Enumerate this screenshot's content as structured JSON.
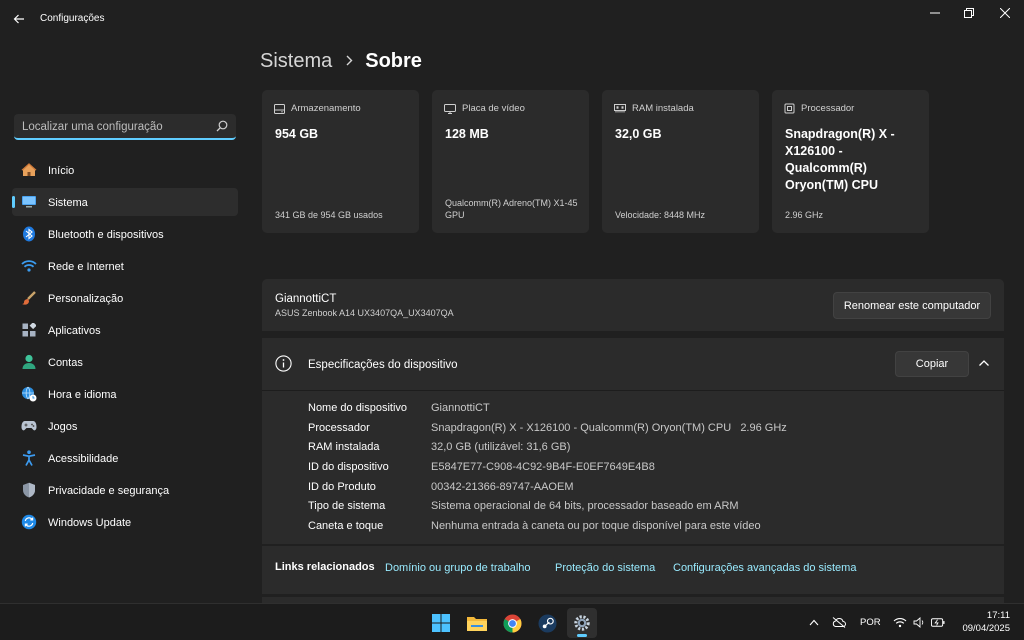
{
  "window": {
    "title": "Configurações"
  },
  "search": {
    "placeholder": "Localizar uma configuração"
  },
  "sidebar": {
    "items": [
      {
        "label": "Início"
      },
      {
        "label": "Sistema"
      },
      {
        "label": "Bluetooth e dispositivos"
      },
      {
        "label": "Rede e Internet"
      },
      {
        "label": "Personalização"
      },
      {
        "label": "Aplicativos"
      },
      {
        "label": "Contas"
      },
      {
        "label": "Hora e idioma"
      },
      {
        "label": "Jogos"
      },
      {
        "label": "Acessibilidade"
      },
      {
        "label": "Privacidade e segurança"
      },
      {
        "label": "Windows Update"
      }
    ],
    "active": "Sistema"
  },
  "breadcrumb": {
    "parent": "Sistema",
    "current": "Sobre"
  },
  "cards": [
    {
      "title": "Armazenamento",
      "value": "954 GB",
      "footer": "341 GB de 954 GB usados",
      "icon": "storage-icon"
    },
    {
      "title": "Placa de vídeo",
      "value": "128 MB",
      "footer": "Qualcomm(R) Adreno(TM) X1-45 GPU",
      "icon": "gpu-icon"
    },
    {
      "title": "RAM instalada",
      "value": "32,0 GB",
      "footer": "Velocidade: 8448 MHz",
      "icon": "ram-icon"
    },
    {
      "title": "Processador",
      "value": "Snapdragon(R) X - X126100 - Qualcomm(R) Oryon(TM) CPU",
      "footer": "2.96 GHz",
      "icon": "cpu-icon"
    }
  ],
  "computer": {
    "name": "GiannottiCT",
    "model": "ASUS Zenbook A14 UX3407QA_UX3407QA",
    "rename_label": "Renomear este computador"
  },
  "specs": {
    "title": "Especificações do dispositivo",
    "copy_label": "Copiar",
    "rows": [
      {
        "key": "Nome do dispositivo",
        "value": "GiannottiCT"
      },
      {
        "key": "Processador",
        "value": "Snapdragon(R) X - X126100 - Qualcomm(R) Oryon(TM) CPU   2.96 GHz"
      },
      {
        "key": "RAM instalada",
        "value": "32,0 GB (utilizável: 31,6 GB)"
      },
      {
        "key": "ID do dispositivo",
        "value": "E5847E77-C908-4C92-9B4F-E0EF7649E4B8"
      },
      {
        "key": "ID do Produto",
        "value": "00342-21366-89747-AAOEM"
      },
      {
        "key": "Tipo de sistema",
        "value": "Sistema operacional de 64 bits, processador baseado em ARM"
      },
      {
        "key": "Caneta e toque",
        "value": "Nenhuma entrada à caneta ou por toque disponível para este vídeo"
      }
    ]
  },
  "links": {
    "label": "Links relacionados",
    "items": [
      {
        "label": "Domínio ou grupo de trabalho"
      },
      {
        "label": "Proteção do sistema"
      },
      {
        "label": "Configurações avançadas do sistema"
      }
    ]
  },
  "taskbar": {
    "apps": [
      "windows-start-icon",
      "file-explorer-icon",
      "chrome-icon",
      "steam-icon",
      "settings-icon"
    ],
    "language": "POR",
    "time": "17:11",
    "date": "09/04/2025"
  },
  "colors": {
    "accent": "#60cdff",
    "link": "#99ebff",
    "background": "#202020",
    "card": "#2b2b2b"
  }
}
